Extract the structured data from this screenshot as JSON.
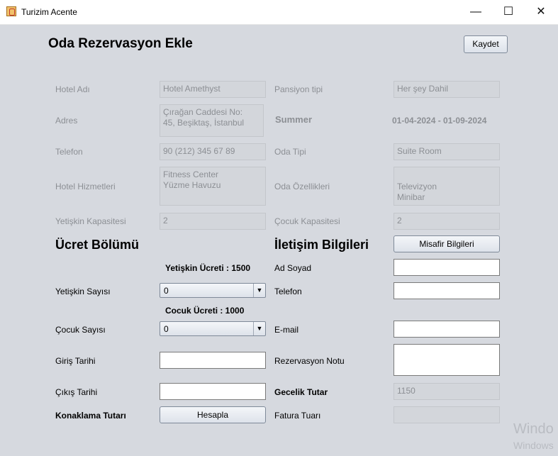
{
  "window": {
    "title": "Turizim Acente",
    "minimize": "—",
    "maximize": "☐",
    "close": "✕"
  },
  "heading": "Oda Rezervasyon Ekle",
  "save_button": "Kaydet",
  "hotel": {
    "name_label": "Hotel Adı",
    "name": "Hotel Amethyst",
    "address_label": "Adres",
    "address": " Çırağan Caddesi No:\n45, Beşiktaş, İstanbul",
    "phone_label": "Telefon",
    "phone": "90 (212) 345 67 89",
    "services_label": "Hotel Hizmetleri",
    "services": "Fitness Center\nYüzme Havuzu",
    "adult_cap_label": "Yetişkin Kapasitesi",
    "adult_cap": "2"
  },
  "room": {
    "board_label": "Pansiyon tipi",
    "board": "Her şey Dahil",
    "season_label": "Summer",
    "season_dates": "01-04-2024 - 01-09-2024",
    "type_label": "Oda Tipi",
    "type": "Suite Room",
    "features_label": "Oda Özellikleri",
    "features": "Televizyon\nMinibar",
    "child_cap_label": "Çocuk Kapasitesi",
    "child_cap": "2"
  },
  "fee": {
    "section_title": "Ücret Bölümü",
    "adult_price": "Yetişkin Ücreti : 1500",
    "adult_count_label": "Yetişkin Sayısı",
    "adult_count": "0",
    "child_price": "Cocuk Ücreti : 1000",
    "child_count_label": "Çocuk Sayısı",
    "child_count": "0",
    "checkin_label": "Giriş Tarihi",
    "checkout_label": "Çıkış Tarihi",
    "total_label": "Konaklama Tutarı",
    "calc_button": "Hesapla"
  },
  "contact": {
    "section_title": "İletişim Bilgileri",
    "guest_button": "Misafir Bilgileri",
    "name_label": "Ad Soyad",
    "phone_label": "Telefon",
    "email_label": "E-mail",
    "note_label": "Rezervasyon Notu",
    "nightly_label": "Gecelik Tutar",
    "nightly": "1150",
    "invoice_label": "Fatura Tuarı"
  },
  "watermark": {
    "line1": "Windo",
    "line2": "Windows"
  }
}
